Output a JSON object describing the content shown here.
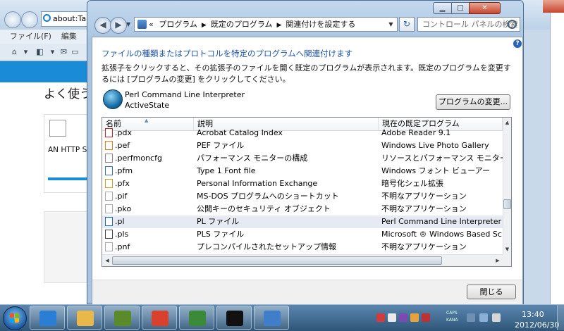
{
  "browser": {
    "address": "about:Tabs",
    "menu": [
      "ファイル(F)",
      "編集(E)"
    ],
    "heading": "よく使う",
    "card_text": "AN HTTP S Options"
  },
  "dialog": {
    "breadcrumb": [
      "«",
      "プログラム",
      "既定のプログラム",
      "関連付けを設定する"
    ],
    "search_placeholder": "コントロール パネルの検索",
    "help": "?",
    "heading": "ファイルの種類またはプロトコルを特定のプログラムへ関連付けます",
    "instructions": "拡張子をクリックすると、その拡張子のファイルを開く既定のプログラムが表示されます。既定のプログラムを変更するには [プログラムの変更] をクリックしてください。",
    "program_name": "Perl Command Line Interpreter",
    "program_vendor": "ActiveState",
    "change_button": "プログラムの変更...",
    "close_button": "閉じる",
    "columns": [
      "名前",
      "説明",
      "現在の既定プログラム"
    ],
    "rows": [
      {
        "ext": ".pdx",
        "desc": "Acrobat Catalog Index",
        "prog": "Adobe Reader 9.1",
        "icon": "pdf-file-icon",
        "color": "#cc2222"
      },
      {
        "ext": ".pef",
        "desc": "PEF ファイル",
        "prog": "Windows Live Photo Gallery",
        "icon": "photo-file-icon",
        "color": "#e07a1a"
      },
      {
        "ext": ".perfmoncfg",
        "desc": "パフォーマンス モニターの構成",
        "prog": "リソースとパフォーマンス モニター",
        "icon": "perfmon-file-icon",
        "color": "#888888"
      },
      {
        "ext": ".pfm",
        "desc": "Type 1 Font file",
        "prog": "Windows フォント ビューアー",
        "icon": "font-file-icon",
        "color": "#3a6fc2"
      },
      {
        "ext": ".pfx",
        "desc": "Personal Information Exchange",
        "prog": "暗号化シェル拡張",
        "icon": "certificate-file-icon",
        "color": "#c8a020"
      },
      {
        "ext": ".pif",
        "desc": "MS-DOS プログラムへのショートカット",
        "prog": "不明なアプリケーション",
        "icon": "blank-file-icon",
        "color": "#aaaaaa"
      },
      {
        "ext": ".pko",
        "desc": "公開キーのセキュリティ オブジェクト",
        "prog": "不明なアプリケーション",
        "icon": "blank-file-icon",
        "color": "#aaaaaa"
      },
      {
        "ext": ".pl",
        "desc": "PL ファイル",
        "prog": "Perl Command Line Interpreter",
        "icon": "perl-file-icon",
        "color": "#1a6ea8"
      },
      {
        "ext": ".pls",
        "desc": "PLS ファイル",
        "prog": "Microsoft ® Windows Based Script Ho",
        "icon": "script-file-icon",
        "color": "#444444"
      },
      {
        "ext": ".pnf",
        "desc": "プレコンパイルされたセットアップ情報",
        "prog": "不明なアプリケーション",
        "icon": "blank-file-icon",
        "color": "#aaaaaa"
      }
    ],
    "selected_row": 7
  },
  "taskbar": {
    "items": [
      "internet-explorer",
      "file-explorer",
      "media-app",
      "chrome",
      "messenger",
      "command-prompt",
      "control-panel"
    ],
    "caps_label": "CAPS",
    "kana_label": "KANA",
    "time": "13:40",
    "date": "2012/06/30"
  },
  "colors": {
    "accent": "#1d53a5",
    "selection": "#e6ebf3",
    "taskbar": "#2e5679"
  }
}
